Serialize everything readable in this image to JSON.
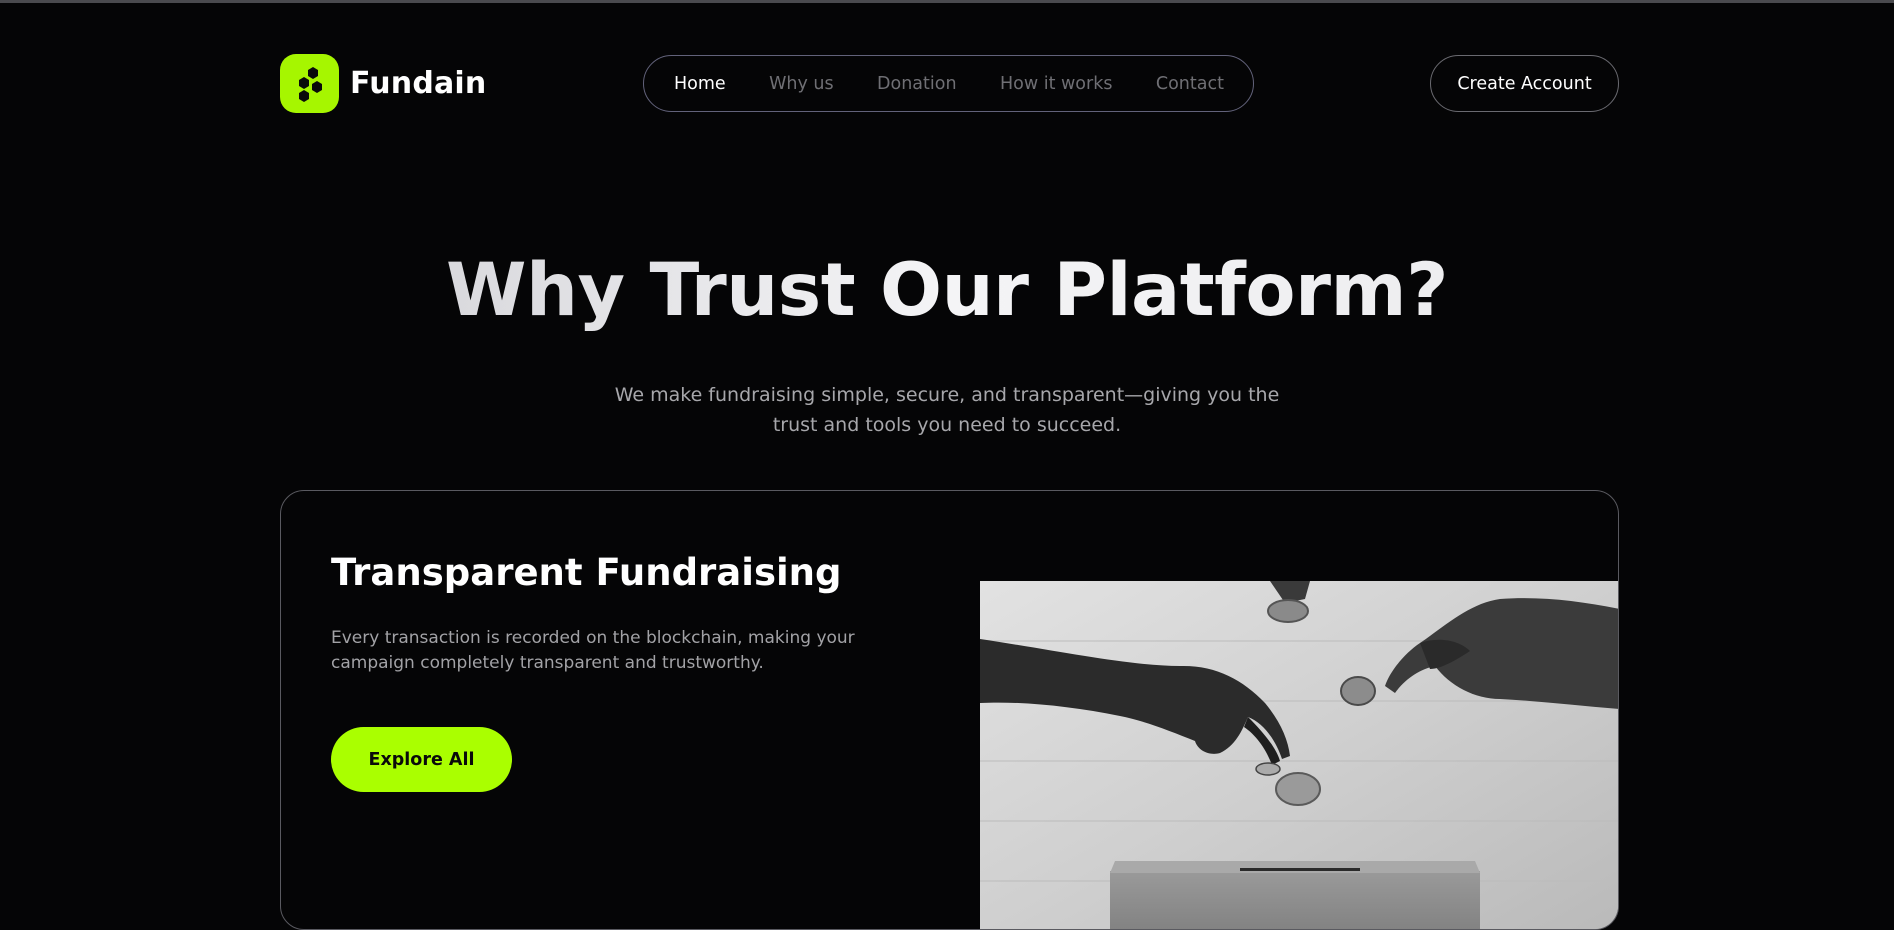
{
  "brand": {
    "name": "Fundain",
    "accent": "#aaff00",
    "icon": "hexagon-cluster-icon"
  },
  "nav": {
    "items": [
      {
        "label": "Home",
        "active": true
      },
      {
        "label": "Why us",
        "active": false
      },
      {
        "label": "Donation",
        "active": false
      },
      {
        "label": "How it works",
        "active": false
      },
      {
        "label": "Contact",
        "active": false
      }
    ]
  },
  "header": {
    "create_account_label": "Create Account"
  },
  "hero": {
    "title": "Why Trust Our Platform?",
    "subtitle": "We make fundraising simple, secure, and transparent—giving you the trust and tools you need to succeed."
  },
  "feature_card": {
    "title": "Transparent Fundraising",
    "description": "Every transaction is recorded on the blockchain, making your campaign completely transparent and trustworthy.",
    "button_label": "Explore All",
    "image": "hands-dropping-coins-into-donation-box"
  },
  "colors": {
    "background": "#050506",
    "accent": "#aaff00",
    "muted_text": "#6f6f74"
  }
}
